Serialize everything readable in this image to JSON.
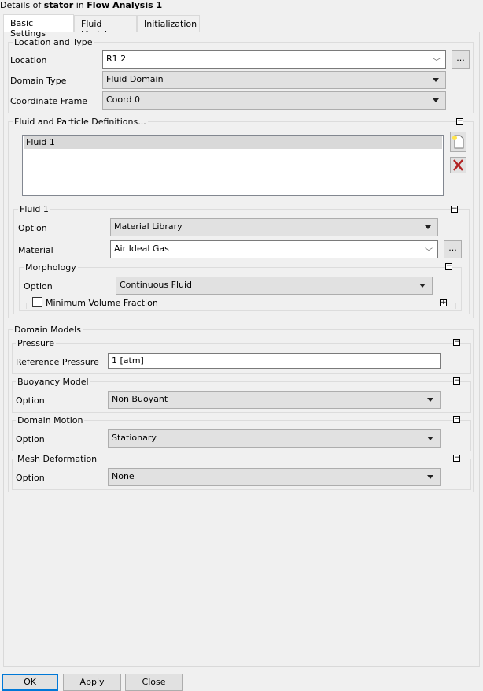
{
  "header": {
    "prefix": "Details of ",
    "object": "stator",
    "middle": " in ",
    "analysis": "Flow Analysis 1"
  },
  "tabs": [
    {
      "label": "Basic Settings",
      "active": true
    },
    {
      "label": "Fluid Models"
    },
    {
      "label": "Initialization"
    }
  ],
  "location_type": {
    "title": "Location and Type",
    "location": {
      "label": "Location",
      "value": "R1 2",
      "browse": "..."
    },
    "domain_type": {
      "label": "Domain Type",
      "value": "Fluid Domain"
    },
    "coord_frame": {
      "label": "Coordinate Frame",
      "value": "Coord 0"
    }
  },
  "fluid_defs": {
    "title": "Fluid and Particle Definitions...",
    "items": [
      "Fluid 1"
    ],
    "selected": "Fluid 1"
  },
  "fluid1": {
    "title": "Fluid 1",
    "option": {
      "label": "Option",
      "value": "Material Library"
    },
    "material": {
      "label": "Material",
      "value": "Air Ideal Gas",
      "browse": "..."
    },
    "morphology": {
      "title": "Morphology",
      "option": {
        "label": "Option",
        "value": "Continuous Fluid"
      },
      "min_vol_fraction": {
        "label": "Minimum Volume Fraction",
        "checked": false
      }
    }
  },
  "domain_models": {
    "title": "Domain Models",
    "pressure": {
      "title": "Pressure",
      "label": "Reference Pressure",
      "value": "1 [atm]"
    },
    "buoyancy": {
      "title": "Buoyancy Model",
      "label": "Option",
      "value": "Non Buoyant"
    },
    "motion": {
      "title": "Domain Motion",
      "label": "Option",
      "value": "Stationary"
    },
    "mesh_def": {
      "title": "Mesh Deformation",
      "label": "Option",
      "value": "None"
    }
  },
  "buttons": {
    "ok": "OK",
    "apply": "Apply",
    "close": "Close"
  },
  "colors": {
    "accent": "#0078d7",
    "delete": "#b22222"
  }
}
